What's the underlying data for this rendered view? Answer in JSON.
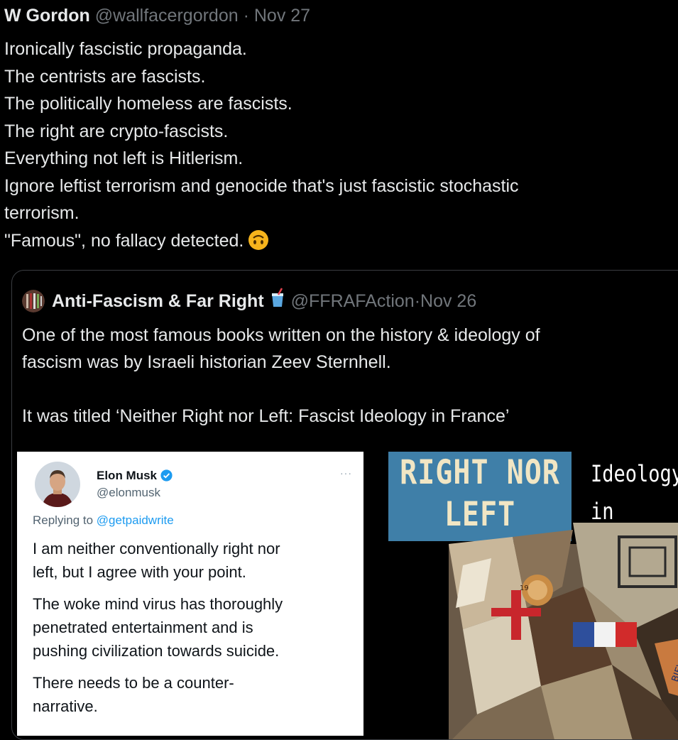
{
  "tweet": {
    "name": "W Gordon",
    "handle": "@wallfacergordon",
    "dot": "·",
    "date": "Nov 27",
    "lines": [
      "Ironically fascistic propaganda.",
      "The centrists are fascists.",
      "The politically homeless are fascists.",
      "The right are crypto-fascists.",
      "Everything not left is Hitlerism.",
      "Ignore leftist terrorism and genocide that's just fascistic stochastic",
      "terrorism.",
      "\"Famous\", no fallacy detected."
    ],
    "emoji": "upside-down-face-icon"
  },
  "quote": {
    "name": "Anti-Fascism & Far Right",
    "emoji": "cup-with-straw-icon",
    "handle": "@FFRAFAction",
    "dot": "·",
    "date": "Nov 26",
    "lines": [
      "One of the most famous books written on the history & ideology of",
      "fascism was by Israeli historian Zeev Sternhell.",
      "It was titled ‘Neither Right nor Left: Fascist Ideology in France’"
    ]
  },
  "embedded_tweet": {
    "name": "Elon Musk",
    "verified_icon": "verified-badge-icon",
    "handle": "@elonmusk",
    "more": "···",
    "replying_prefix": "Replying to ",
    "replying_handle": "@getpaidwrite",
    "paragraphs": [
      [
        "I am neither conventionally right nor",
        "left, but I agree with your point."
      ],
      [
        "The woke mind virus has thoroughly",
        "penetrated entertainment and is",
        "pushing civilization towards suicide."
      ],
      [
        "There needs to be a counter-",
        "narrative."
      ]
    ]
  },
  "book_cover": {
    "title_line1": "RIGHT NOR",
    "title_line2": "LEFT",
    "sub_line1": "Ideology",
    "sub_line2": "in France",
    "art_signature": "BIEVRE",
    "art_number": "19"
  },
  "colors": {
    "background": "#000000",
    "text": "#e7e9ea",
    "muted": "#71767b",
    "link": "#1d9bf0",
    "cover_blue": "#3f7fa8"
  }
}
